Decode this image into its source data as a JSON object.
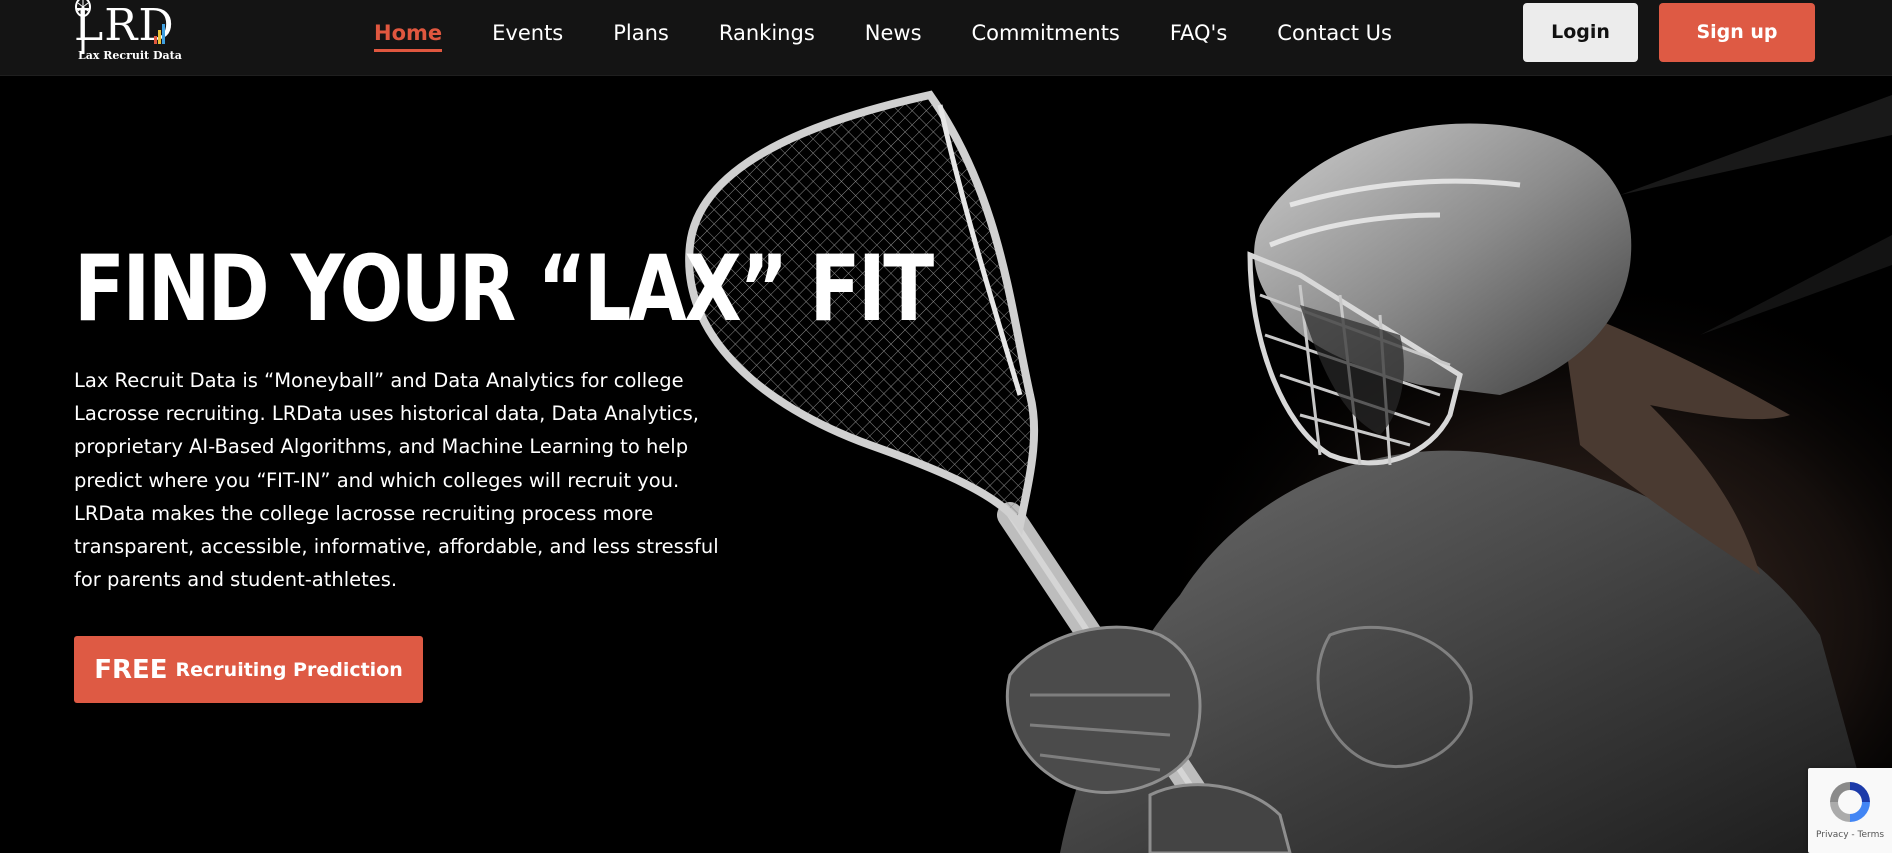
{
  "brand": {
    "logo_letters": "LRD",
    "logo_subtitle": "Lax Recruit Data"
  },
  "nav": {
    "links": [
      {
        "label": "Home",
        "active": true
      },
      {
        "label": "Events",
        "active": false
      },
      {
        "label": "Plans",
        "active": false
      },
      {
        "label": "Rankings",
        "active": false
      },
      {
        "label": "News",
        "active": false
      },
      {
        "label": "Commitments",
        "active": false
      },
      {
        "label": "FAQ's",
        "active": false
      },
      {
        "label": "Contact Us",
        "active": false
      }
    ],
    "login_label": "Login",
    "signup_label": "Sign up"
  },
  "hero": {
    "title": "FIND YOUR “LAX” FIT",
    "body_lines": [
      "Lax Recruit Data is “Moneyball” and Data Analytics for college",
      "Lacrosse recruiting. LRData uses historical data, Data Analytics,",
      "proprietary AI-Based Algorithms, and Machine Learning to help",
      "predict where you “FIT-IN” and which colleges will recruit you.",
      "LRData makes the college lacrosse recruiting process more",
      "transparent, accessible, informative, affordable, and less stressful",
      "for parents and student-athletes."
    ],
    "cta_strong": "FREE",
    "cta_rest": "Recruiting Prediction",
    "image_subject": "lacrosse-player-photo"
  },
  "recaptcha": {
    "text": "Privacy - Terms",
    "icon": "recaptcha-icon"
  },
  "colors": {
    "accent": "#de5a44",
    "nav_background": "#141414",
    "hero_background": "#000000",
    "login_background": "#ececec"
  }
}
